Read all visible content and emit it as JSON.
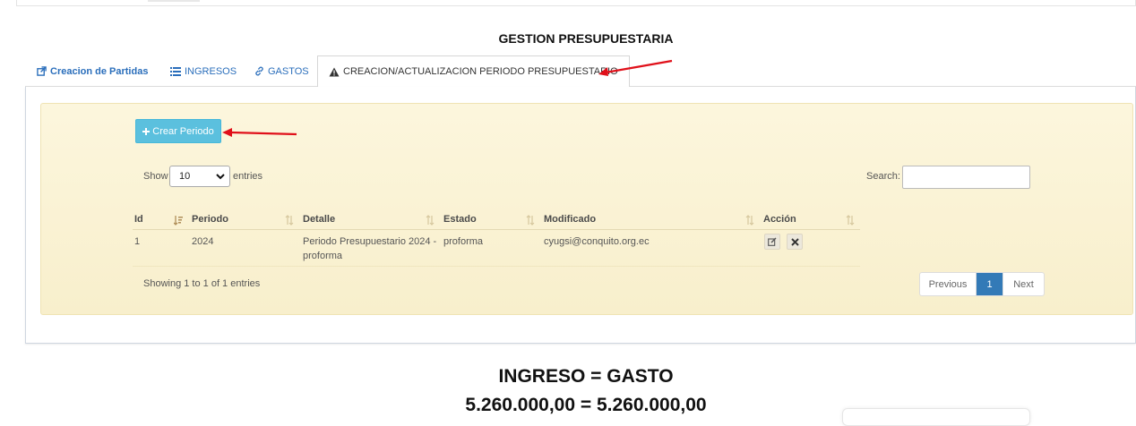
{
  "page": {
    "title": "GESTION PRESUPUESTARIA"
  },
  "tabs": [
    {
      "label": "Creacion de Partidas",
      "icon": "external-link-icon"
    },
    {
      "label": "INGRESOS",
      "icon": "list-icon"
    },
    {
      "label": "GASTOS",
      "icon": "link-icon"
    },
    {
      "label": "CREACION/ACTUALIZACION PERIODO PRESUPUESTARIO",
      "icon": "warning-icon",
      "active": true
    }
  ],
  "toolbar": {
    "create_label": "Crear Periodo"
  },
  "length_control": {
    "prefix": "Show",
    "value": "10",
    "suffix": "entries"
  },
  "search": {
    "label": "Search:",
    "value": ""
  },
  "table": {
    "columns": [
      "Id",
      "Periodo",
      "Detalle",
      "Estado",
      "Modificado",
      "Acción"
    ],
    "rows": [
      {
        "id": "1",
        "periodo": "2024",
        "detalle_line1": "Periodo Presupuestario 2024 -",
        "detalle_line2": "proforma",
        "estado": "proforma",
        "modificado": "cyugsi@conquito.org.ec",
        "actions": [
          "edit-icon",
          "delete-icon"
        ]
      }
    ]
  },
  "info": "Showing 1 to 1 of 1 entries",
  "pagination": {
    "previous": "Previous",
    "current": "1",
    "next": "Next"
  },
  "summary": {
    "equation": "INGRESO = GASTO",
    "values": "5.260.000,00 = 5.260.000,00"
  },
  "colors": {
    "accent": "#5bc0de",
    "link": "#2a6ebb",
    "page_active": "#337ab7",
    "well": "#fcf6dd",
    "annotation_arrow": "#e0101a"
  }
}
